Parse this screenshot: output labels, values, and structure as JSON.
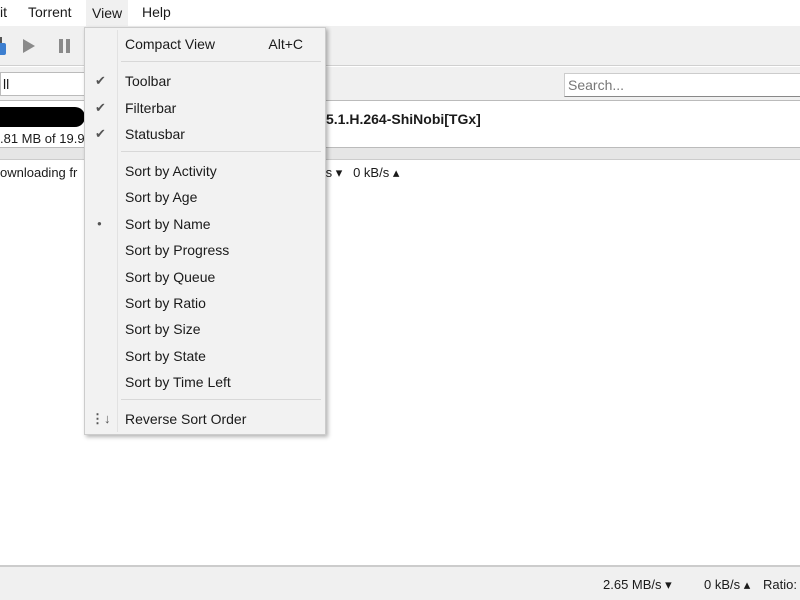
{
  "menubar": {
    "items": [
      "it",
      "Torrent",
      "View",
      "Help"
    ]
  },
  "filterbar": {
    "filter": "ll",
    "search_placeholder": "Search..."
  },
  "torrent": {
    "name": "5.1.H.264-ShiNobi[TGx]",
    "size": ".81 MB of 19.9",
    "status": "ownloading fr",
    "down": "/s ▾",
    "up": "0 kB/s ▴"
  },
  "statusbar": {
    "down": "2.65 MB/s ▾",
    "up": "0 kB/s ▴",
    "ratio": "Ratio:"
  },
  "view_menu": {
    "compact": {
      "label": "Compact View",
      "shortcut": "Alt+C"
    },
    "toggles": [
      {
        "label": "Toolbar",
        "checked": true
      },
      {
        "label": "Filterbar",
        "checked": true
      },
      {
        "label": "Statusbar",
        "checked": true
      }
    ],
    "sorts": [
      {
        "label": "Sort by Activity"
      },
      {
        "label": "Sort by Age"
      },
      {
        "label": "Sort by Name",
        "selected": true
      },
      {
        "label": "Sort by Progress"
      },
      {
        "label": "Sort by Queue"
      },
      {
        "label": "Sort by Ratio"
      },
      {
        "label": "Sort by Size"
      },
      {
        "label": "Sort by State"
      },
      {
        "label": "Sort by Time Left"
      }
    ],
    "reverse": {
      "label": "Reverse Sort Order"
    }
  }
}
